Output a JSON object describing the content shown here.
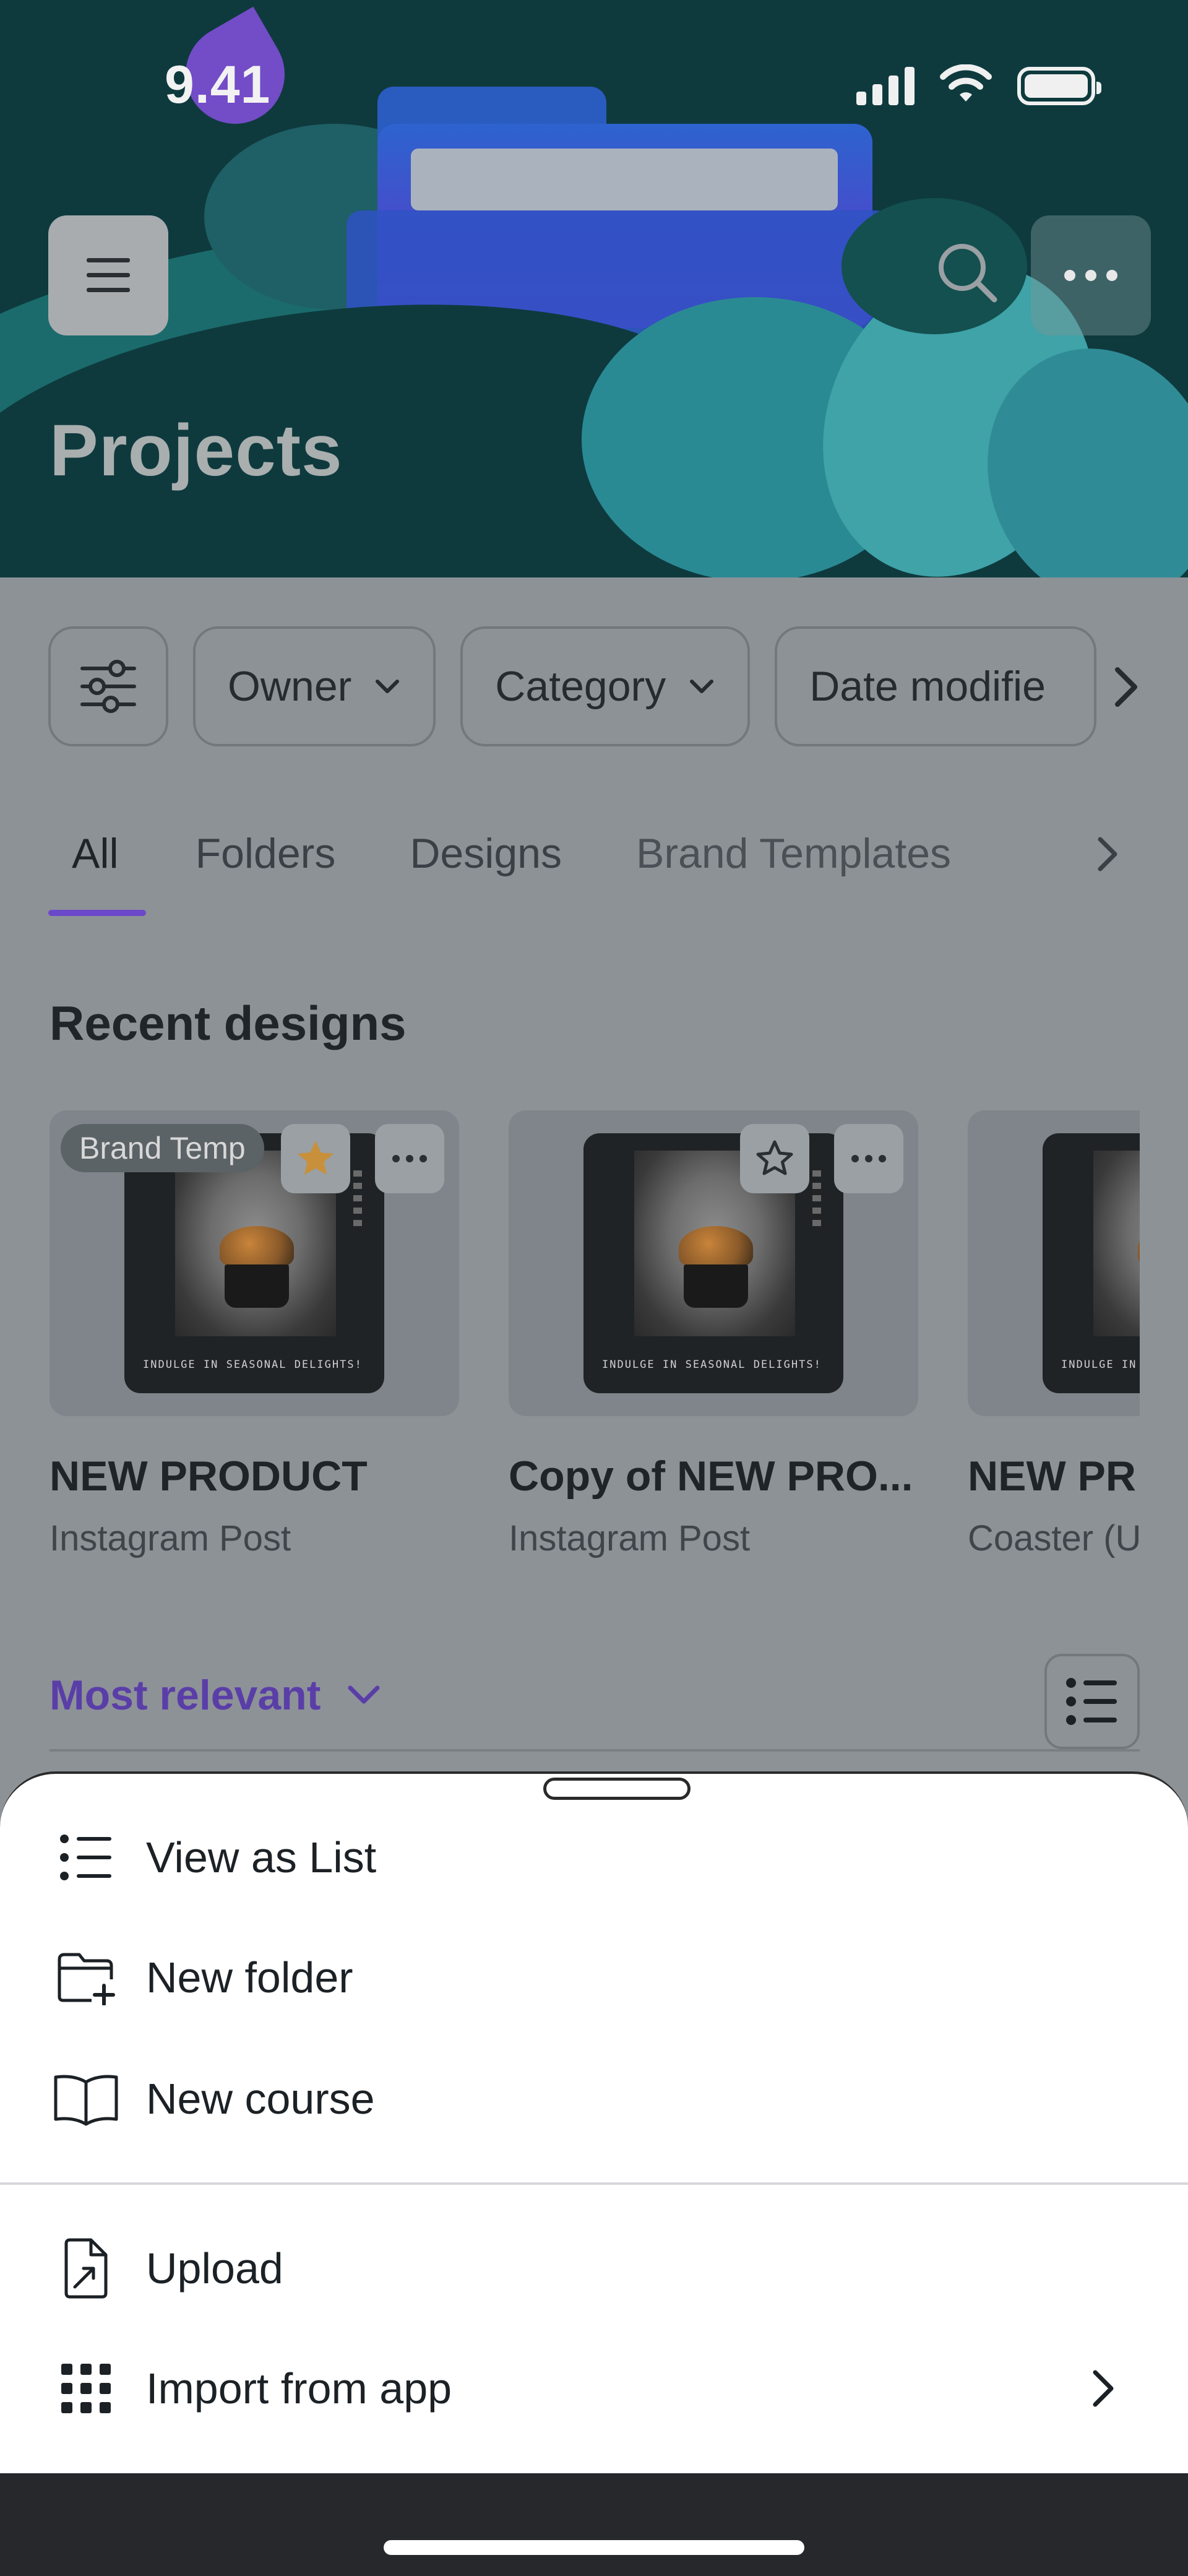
{
  "status_bar": {
    "time": "9.41"
  },
  "header": {
    "title": "Projects"
  },
  "filters": [
    {
      "label": "Owner"
    },
    {
      "label": "Category"
    },
    {
      "label": "Date modifie"
    }
  ],
  "tabs": [
    {
      "label": "All",
      "active": true
    },
    {
      "label": "Folders"
    },
    {
      "label": "Designs"
    },
    {
      "label": "Brand Templates"
    }
  ],
  "recent": {
    "title": "Recent designs",
    "cards": [
      {
        "badge": "Brand Temp",
        "starred": true,
        "thumb_text": "INDULGE IN SEASONAL DELIGHTS!",
        "title": "NEW PRODUCT",
        "subtitle": "Instagram Post"
      },
      {
        "starred": false,
        "thumb_text": "INDULGE IN SEASONAL DELIGHTS!",
        "title": "Copy of NEW PRO...",
        "subtitle": "Instagram Post"
      },
      {
        "thumb_text": "INDULGE IN",
        "title": "NEW PR",
        "subtitle": "Coaster (U"
      }
    ]
  },
  "sort": {
    "label": "Most relevant"
  },
  "sheet": {
    "items": [
      {
        "label": "View as List",
        "icon": "list-icon"
      },
      {
        "label": "New folder",
        "icon": "folder-plus-icon"
      },
      {
        "label": "New course",
        "icon": "book-open-icon"
      },
      {
        "label": "Upload",
        "icon": "file-upload-icon"
      },
      {
        "label": "Import from app",
        "icon": "grid-dots-icon"
      }
    ]
  },
  "colors": {
    "accent": "#6b48c9",
    "header_bg": "#0e3a3e",
    "star": "#c8903a"
  }
}
